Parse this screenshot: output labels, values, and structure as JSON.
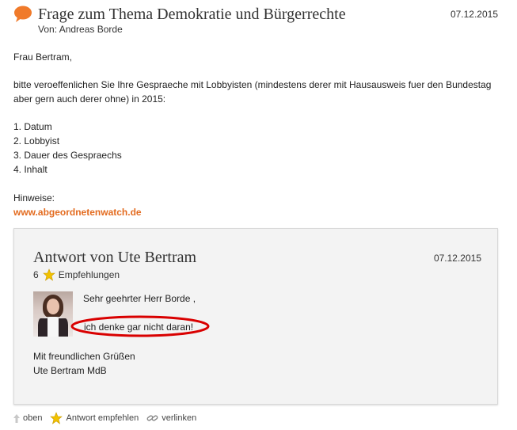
{
  "question": {
    "title": "Frage zum Thema Demokratie und Bürgerrechte",
    "date": "07.12.2015",
    "from": "Von: Andreas Borde",
    "salutation": "Frau Bertram,",
    "request_line1": "bitte veroeffenlichen Sie Ihre Gespraeche mit Lobbyisten (mindestens derer mit Hausausweis fuer den Bundestag",
    "request_line2": "aber gern auch derer ohne) in 2015:",
    "items": [
      "1. Datum",
      "2. Lobbyist",
      "3. Dauer des Gespraechs",
      "4. Inhalt"
    ],
    "hint_label": "Hinweise:",
    "hint_link": "www.abgeordnetenwatch.de"
  },
  "answer": {
    "title": "Antwort von Ute Bertram",
    "date": "07.12.2015",
    "recommend_count": "6",
    "recommend_label": "Empfehlungen",
    "greeting": "Sehr geehrter Herr Borde ,",
    "text": "ich denke gar nicht daran!",
    "closing1": "Mit freundlichen Grüßen",
    "closing2": "Ute Bertram MdB"
  },
  "footer": {
    "top_label": "oben",
    "recommend_label": "Antwort empfehlen",
    "link_label": "verlinken"
  },
  "colors": {
    "accent": "#e36b1f",
    "highlight": "#d90000",
    "star": "#f2c200"
  },
  "icons": [
    "speech-bubble-icon",
    "star-icon",
    "arrow-up-icon",
    "link-icon"
  ]
}
